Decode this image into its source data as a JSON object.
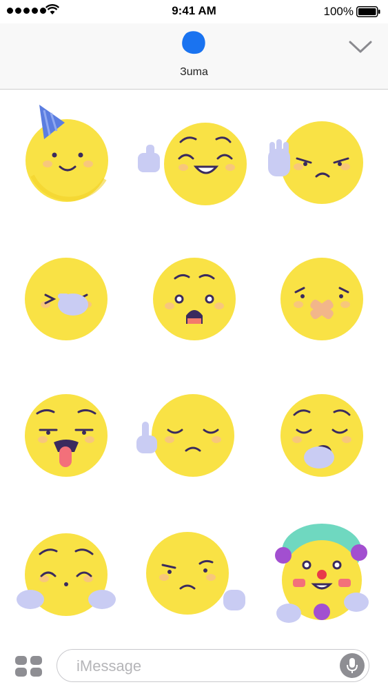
{
  "status_bar": {
    "time": "9:41 AM",
    "battery_percent": "100%",
    "signal_bars": 5,
    "icons": [
      "signal-dots-icon",
      "wifi-icon",
      "battery-icon"
    ]
  },
  "header": {
    "app_name": "Зuma",
    "app_icon": "blue-blob-icon",
    "collapse_icon": "chevron-down-icon",
    "accent_color": "#1a73f0"
  },
  "stickers": [
    {
      "name": "party-hat-smile-sticker"
    },
    {
      "name": "thumbs-up-grin-sticker"
    },
    {
      "name": "raised-hand-annoyed-sticker"
    },
    {
      "name": "hand-over-mouth-sticker"
    },
    {
      "name": "shocked-face-sticker"
    },
    {
      "name": "bandaged-mouth-sticker"
    },
    {
      "name": "tongue-out-sticker"
    },
    {
      "name": "finger-pointing-sad-sticker"
    },
    {
      "name": "yawning-sticker"
    },
    {
      "name": "two-hands-whistle-sticker"
    },
    {
      "name": "skeptical-hand-sticker"
    },
    {
      "name": "clown-sticker"
    }
  ],
  "composer": {
    "placeholder": "iMessage",
    "apps_icon": "app-drawer-icon",
    "mic_icon": "microphone-icon"
  },
  "colors": {
    "face": "#f9e245",
    "face_shade": "#f2d22a",
    "cheek": "#f8c77b",
    "ink": "#3a2a5e",
    "hand": "#c9ccf3"
  }
}
